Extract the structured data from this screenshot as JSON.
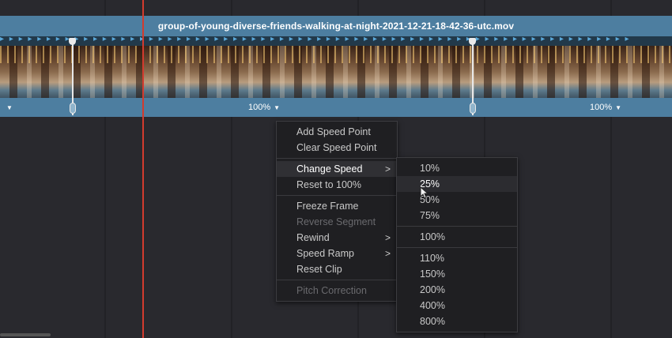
{
  "clip": {
    "filename": "group-of-young-diverse-friends-walking-at-night-2021-12-21-18-42-36-utc.mov",
    "speed_labels": [
      "100%",
      "100%"
    ]
  },
  "context_menu": {
    "items": [
      {
        "label": "Add Speed Point",
        "enabled": true
      },
      {
        "label": "Clear Speed Point",
        "enabled": true
      },
      {
        "label": "Change Speed",
        "enabled": true,
        "has_submenu": true,
        "highlighted": true
      },
      {
        "label": "Reset to 100%",
        "enabled": true
      },
      {
        "label": "Freeze Frame",
        "enabled": true
      },
      {
        "label": "Reverse Segment",
        "enabled": false
      },
      {
        "label": "Rewind",
        "enabled": true,
        "has_submenu": true
      },
      {
        "label": "Speed Ramp",
        "enabled": true,
        "has_submenu": true
      },
      {
        "label": "Reset Clip",
        "enabled": true
      },
      {
        "label": "Pitch Correction",
        "enabled": false
      }
    ],
    "submenu_arrow": ">"
  },
  "speed_submenu": {
    "options": [
      "10%",
      "25%",
      "50%",
      "75%",
      "100%",
      "110%",
      "150%",
      "200%",
      "400%",
      "800%"
    ],
    "hovered": "25%"
  },
  "icons": {
    "dropdown": "▼",
    "marker": "▶"
  },
  "colors": {
    "clip_blue": "#4d7ea0",
    "playhead_red": "#d23b2e",
    "menu_bg": "#1f1f22"
  }
}
